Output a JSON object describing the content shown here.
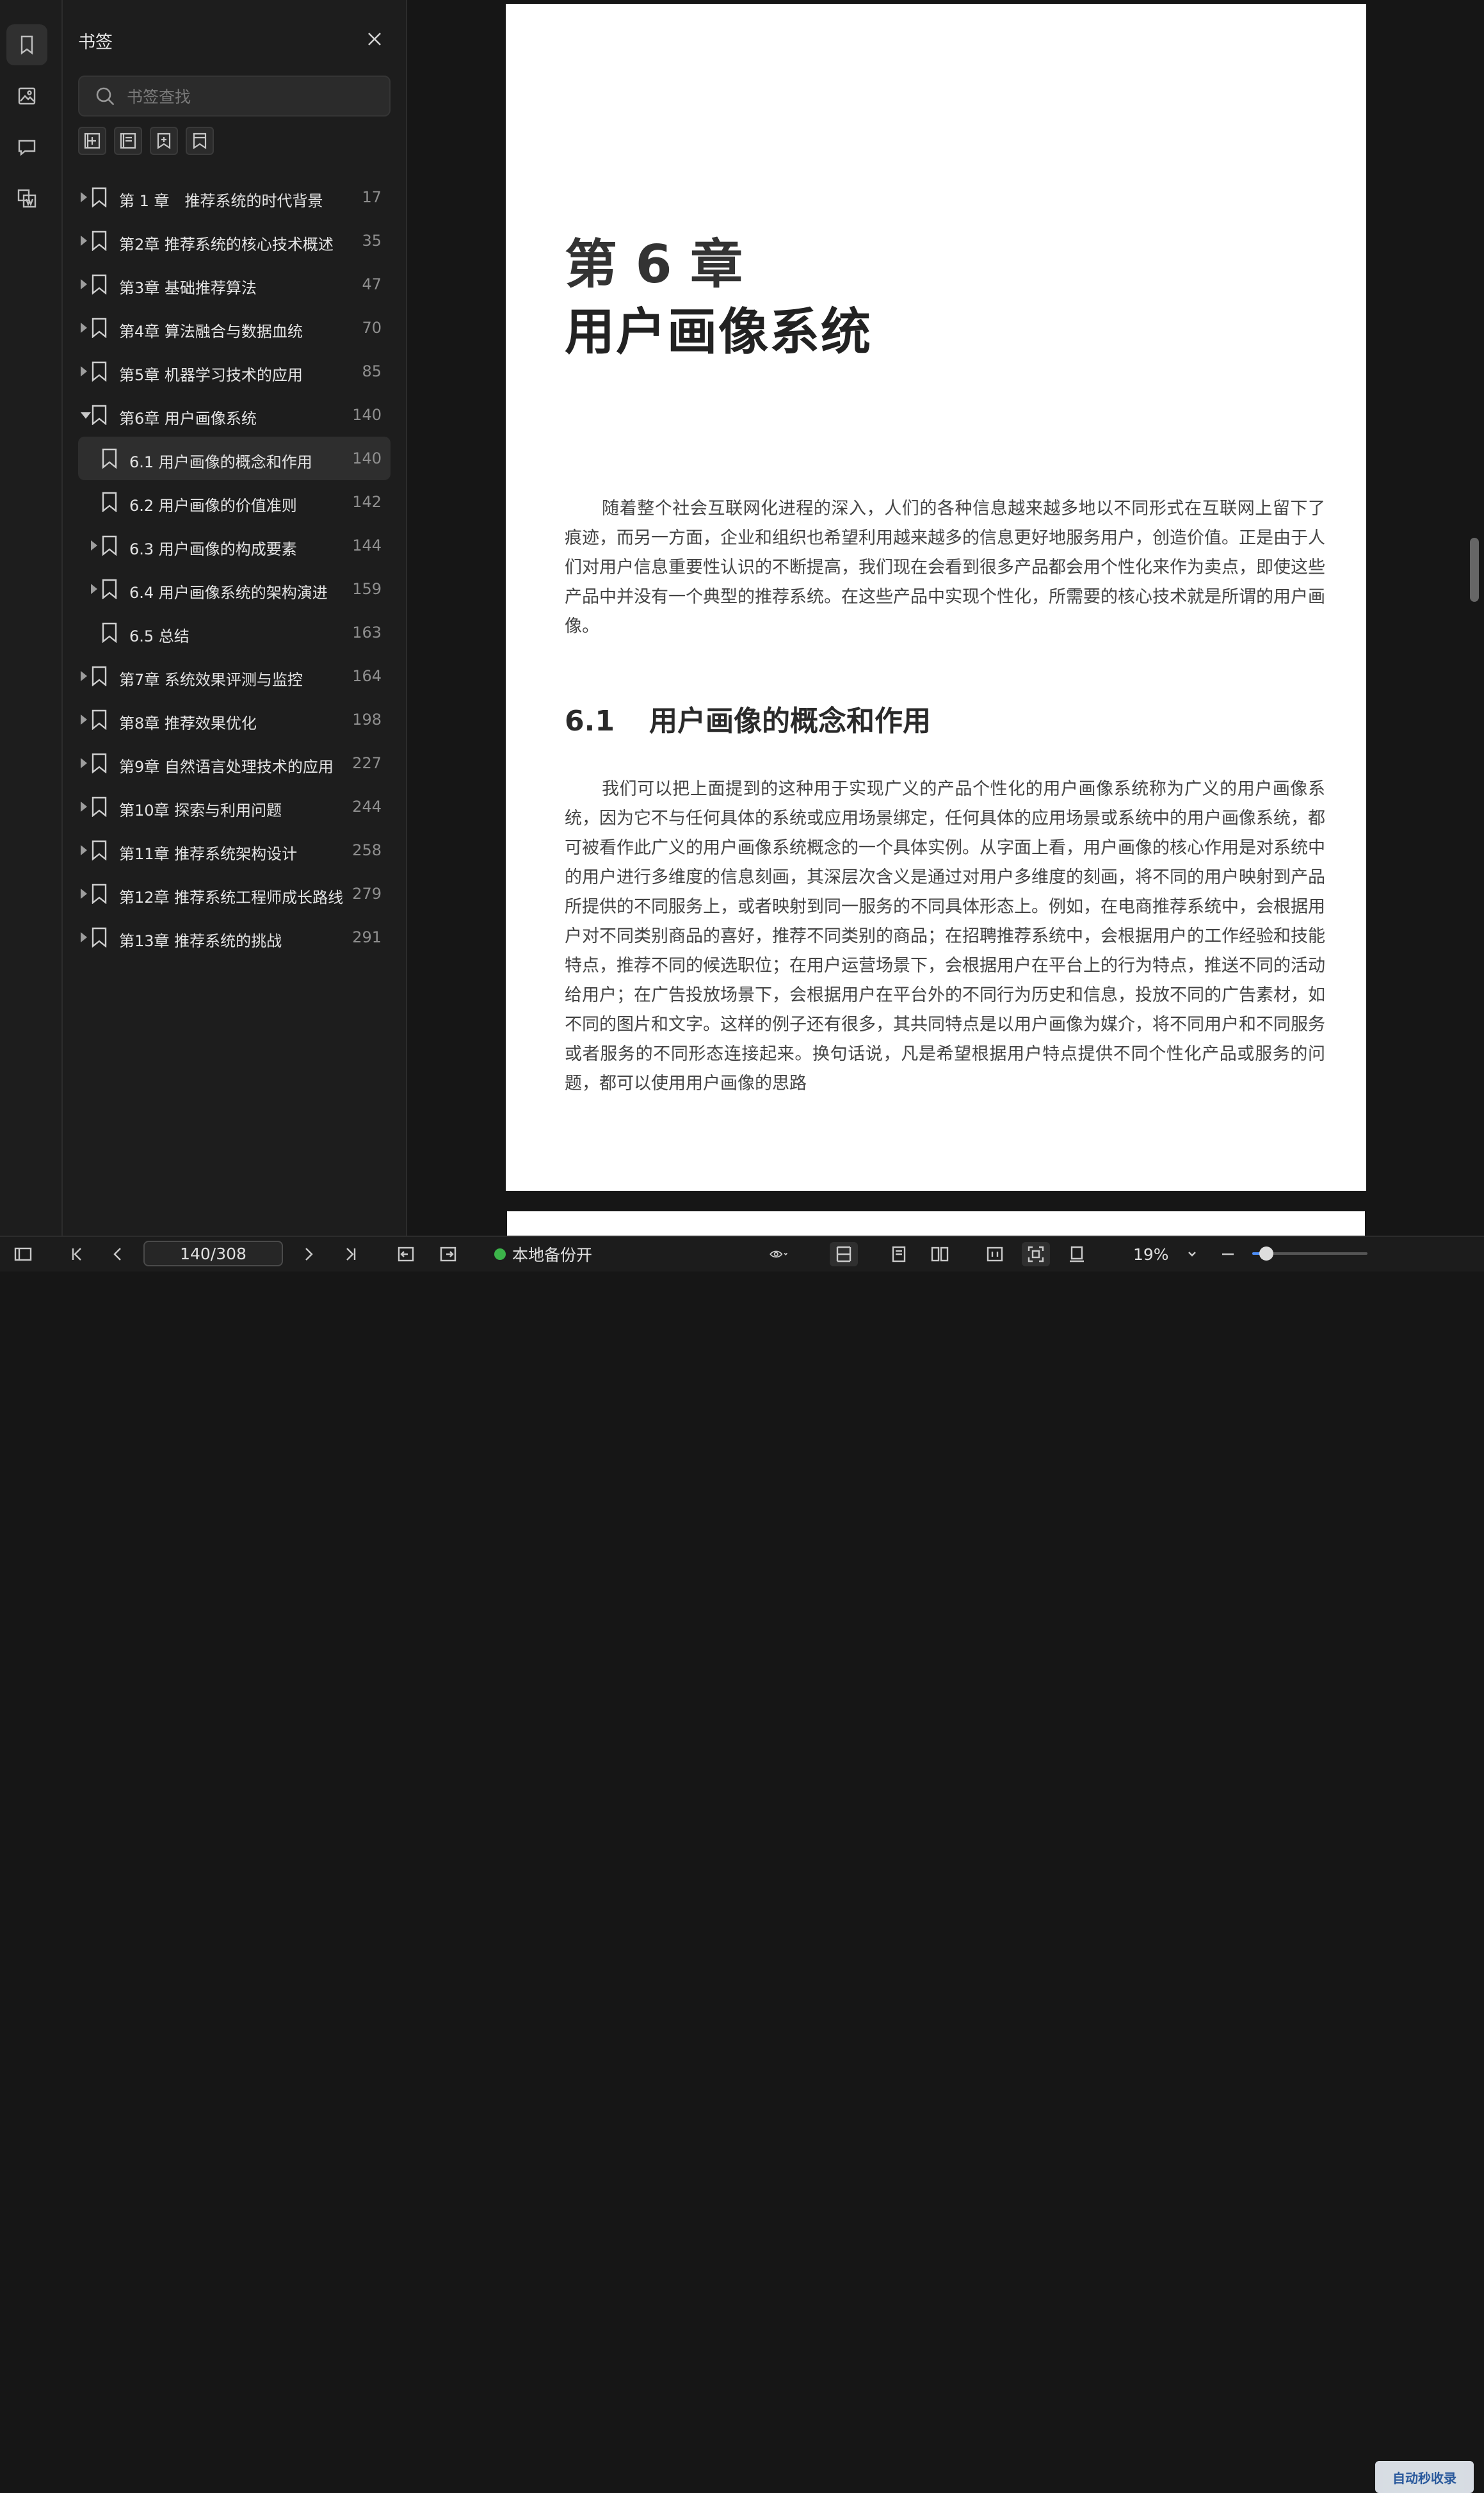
{
  "sidebar_rail": {
    "icons": [
      "bookmark-icon",
      "image-icon",
      "comment-icon",
      "thumbnail-icon"
    ]
  },
  "bookmarks_panel": {
    "title": "书签",
    "search_placeholder": "书签查找",
    "tool_icons": [
      "add-bookmark-icon",
      "collapse-bookmark-icon",
      "add-child-bookmark-icon",
      "bookmark-outline-icon"
    ],
    "items": [
      {
        "label": "第 1 章　推荐系统的时代背景",
        "page": "17",
        "level": 0,
        "caret": "closed"
      },
      {
        "label": "第2章 推荐系统的核心技术概述",
        "page": "35",
        "level": 0,
        "caret": "closed"
      },
      {
        "label": "第3章 基础推荐算法",
        "page": "47",
        "level": 0,
        "caret": "closed"
      },
      {
        "label": "第4章 算法融合与数据血统",
        "page": "70",
        "level": 0,
        "caret": "closed"
      },
      {
        "label": "第5章 机器学习技术的应用",
        "page": "85",
        "level": 0,
        "caret": "closed"
      },
      {
        "label": "第6章 用户画像系统",
        "page": "140",
        "level": 0,
        "caret": "open"
      },
      {
        "label": "6.1 用户画像的概念和作用",
        "page": "140",
        "level": 1,
        "caret": "none",
        "selected": true
      },
      {
        "label": "6.2 用户画像的价值准则",
        "page": "142",
        "level": 1,
        "caret": "none"
      },
      {
        "label": "6.3 用户画像的构成要素",
        "page": "144",
        "level": 1,
        "caret": "closed"
      },
      {
        "label": "6.4 用户画像系统的架构演进",
        "page": "159",
        "level": 1,
        "caret": "closed"
      },
      {
        "label": "6.5 总结",
        "page": "163",
        "level": 1,
        "caret": "none"
      },
      {
        "label": "第7章 系统效果评测与监控",
        "page": "164",
        "level": 0,
        "caret": "closed"
      },
      {
        "label": "第8章 推荐效果优化",
        "page": "198",
        "level": 0,
        "caret": "closed"
      },
      {
        "label": "第9章 自然语言处理技术的应用",
        "page": "227",
        "level": 0,
        "caret": "closed"
      },
      {
        "label": "第10章 探索与利用问题",
        "page": "244",
        "level": 0,
        "caret": "closed"
      },
      {
        "label": "第11章 推荐系统架构设计",
        "page": "258",
        "level": 0,
        "caret": "closed"
      },
      {
        "label": "第12章 推荐系统工程师成长路线",
        "page": "279",
        "level": 0,
        "caret": "closed"
      },
      {
        "label": "第13章 推荐系统的挑战",
        "page": "291",
        "level": 0,
        "caret": "closed"
      }
    ]
  },
  "document": {
    "chapter_number": "第 6 章",
    "chapter_title": "用户画像系统",
    "paragraph1": "随着整个社会互联网化进程的深入，人们的各种信息越来越多地以不同形式在互联网上留下了痕迹，而另一方面，企业和组织也希望利用越来越多的信息更好地服务用户，创造价值。正是由于人们对用户信息重要性认识的不断提高，我们现在会看到很多产品都会用个性化来作为卖点，即使这些产品中并没有一个典型的推荐系统。在这些产品中实现个性化，所需要的核心技术就是所谓的用户画像。",
    "section_number": "6.1",
    "section_title": "用户画像的概念和作用",
    "paragraph2": "我们可以把上面提到的这种用于实现广义的产品个性化的用户画像系统称为广义的用户画像系统，因为它不与任何具体的系统或应用场景绑定，任何具体的应用场景或系统中的用户画像系统，都可被看作此广义的用户画像系统概念的一个具体实例。从字面上看，用户画像的核心作用是对系统中的用户进行多维度的信息刻画，其深层次含义是通过对用户多维度的刻画，将不同的用户映射到产品所提供的不同服务上，或者映射到同一服务的不同具体形态上。例如，在电商推荐系统中，会根据用户对不同类别商品的喜好，推荐不同类别的商品；在招聘推荐系统中，会根据用户的工作经验和技能特点，推荐不同的候选职位；在用户运营场景下，会根据用户在平台上的行为特点，推送不同的活动给用户；在广告投放场景下，会根据用户在平台外的不同行为历史和信息，投放不同的广告素材，如不同的图片和文字。这样的例子还有很多，其共同特点是以用户画像为媒介，将不同用户和不同服务或者服务的不同形态连接起来。换句话说，凡是希望根据用户特点提供不同个性化产品或服务的问题，都可以使用用户画像的思路"
  },
  "status_bar": {
    "page_indicator": "140/308",
    "backup_label": "本地备份开",
    "zoom_level": "19%",
    "zoom_fraction": 0.12,
    "watermark": "自动秒收录"
  }
}
